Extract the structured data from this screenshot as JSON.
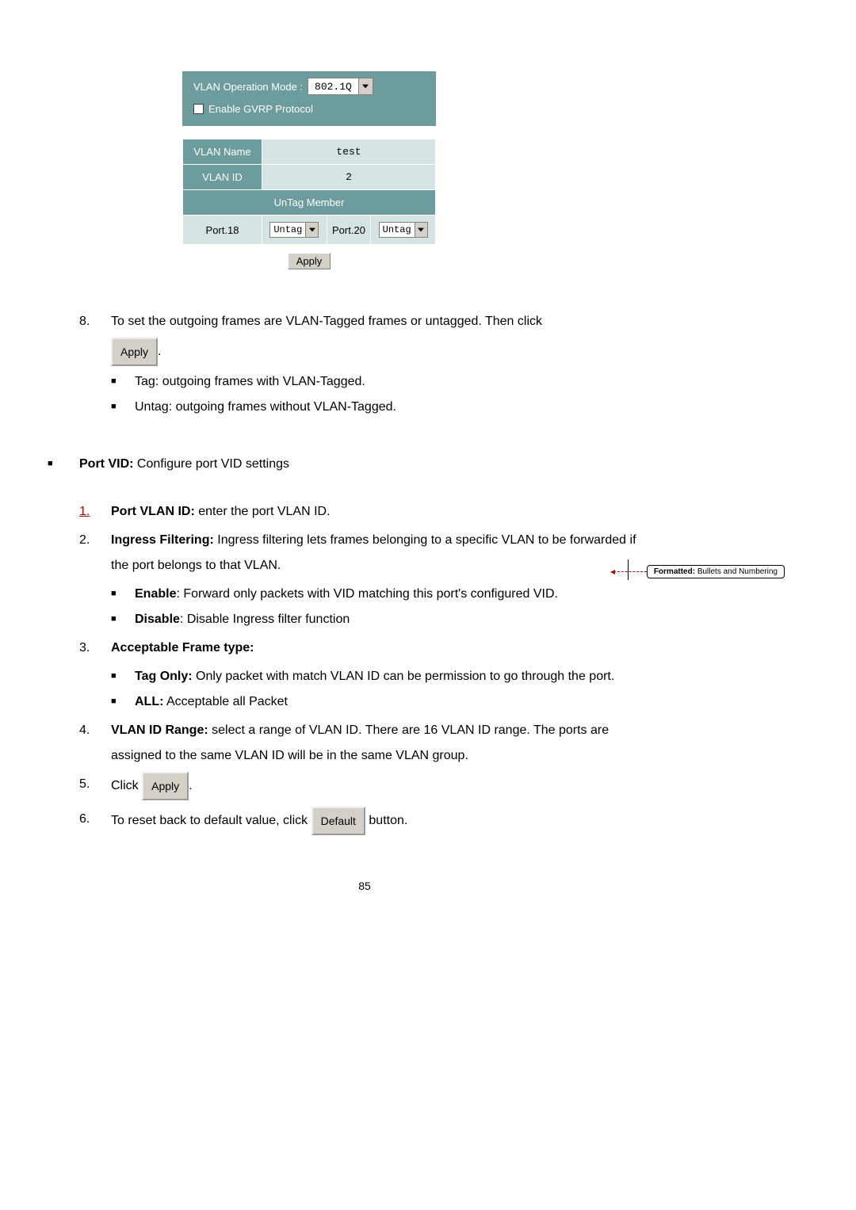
{
  "panel": {
    "mode_label": "VLAN Operation Mode :",
    "mode_value": "802.1Q",
    "gvrp_label": "Enable GVRP Protocol",
    "row_vlan_name_label": "VLAN Name",
    "row_vlan_name_value": "test",
    "row_vlan_id_label": "VLAN ID",
    "row_vlan_id_value": "2",
    "untag_header": "UnTag Member",
    "port18_label": "Port.18",
    "port18_value": "Untag",
    "port20_label": "Port.20",
    "port20_value": "Untag",
    "apply_label": "Apply"
  },
  "step8": {
    "num": "8.",
    "text_a": "To set the outgoing frames are VLAN-Tagged frames or untagged. Then click",
    "btn": "Apply",
    "period": ".",
    "bullet_tag": "Tag: outgoing frames with VLAN-Tagged.",
    "bullet_untag": "Untag: outgoing frames without VLAN-Tagged."
  },
  "portvid": {
    "label_bold": "Port VID:",
    "label_rest": " Configure port VID settings"
  },
  "list": {
    "i1_num": "1.",
    "i1_bold": "Port VLAN ID:",
    "i1_rest": " enter the port VLAN ID.",
    "i2_num": "2.",
    "i2_bold": "Ingress Filtering:",
    "i2_rest": " Ingress filtering lets frames belonging to a specific VLAN to be forwarded if the port belongs to that VLAN.",
    "i2_b1_bold": "Enable",
    "i2_b1_rest": ": Forward only packets with VID matching this port's configured VID.",
    "i2_b2_bold": "Disable",
    "i2_b2_rest": ": Disable Ingress filter function",
    "i3_num": "3.",
    "i3_bold": "Acceptable Frame type:",
    "i3_b1_bold": "Tag Only:",
    "i3_b1_rest": " Only packet with match VLAN ID can be permission to go through the port.",
    "i3_b2_bold": "ALL:",
    "i3_b2_rest": " Acceptable all Packet",
    "i4_num": "4.",
    "i4_bold": "VLAN ID Range:",
    "i4_rest": " select a range of VLAN ID. There are 16 VLAN ID range. The ports are assigned to the same VLAN ID will be in the same VLAN group.",
    "i5_num": "5.",
    "i5_text": "Click ",
    "i5_btn": "Apply",
    "i5_period": ".",
    "i6_num": "6.",
    "i6_text_a": "To reset back to default value, click ",
    "i6_btn": "Default",
    "i6_text_b": " button."
  },
  "revision": {
    "bold": "Formatted:",
    "rest": " Bullets and Numbering"
  },
  "page_number": "85"
}
